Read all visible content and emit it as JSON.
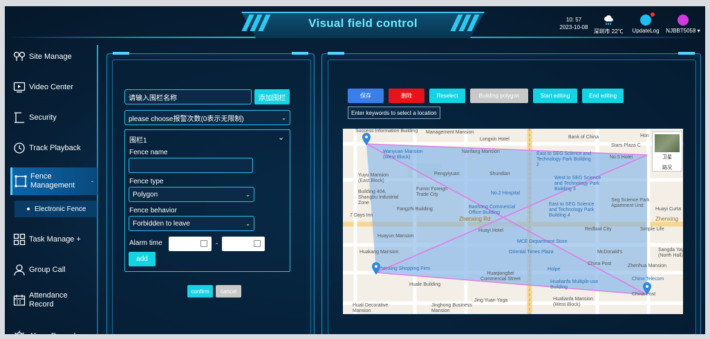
{
  "header": {
    "title": "Visual field control",
    "time": "10: 57",
    "date": "2023-10-08",
    "weather": "深圳市 22℃",
    "updatelog": "UpdateLog",
    "user": "NJBBT5058"
  },
  "sidebar": {
    "items": [
      {
        "label": "Site Manage",
        "icon": "location-pins-icon"
      },
      {
        "label": "Video Center",
        "icon": "video-play-icon"
      },
      {
        "label": "Security",
        "icon": "camera-icon"
      },
      {
        "label": "Track Playback",
        "icon": "history-icon"
      },
      {
        "label_lines": [
          "Fence",
          "Management"
        ],
        "caret": "-",
        "icon": "fence-icon"
      },
      {
        "label": "Task Manage +",
        "icon": "tasks-icon"
      },
      {
        "label": "Group Call",
        "icon": "group-icon"
      },
      {
        "label_lines": [
          "Attendance",
          "Record"
        ],
        "icon": "calendar-icon"
      },
      {
        "label": "Alarm Record",
        "icon": "alarm-icon"
      }
    ],
    "sub_item": "Electronic Fence"
  },
  "left_panel": {
    "fence_name_input": "请输入围栏名称",
    "add_fence_button": "添加围栏",
    "alarm_count_select": "please choose报警次数(0表示无限制)",
    "card": {
      "title": "围栏1",
      "fence_name_label": "Fence name",
      "fence_name_value": "",
      "fence_type_label": "Fence type",
      "fence_type_value": "Polygon",
      "fence_behavior_label": "Fence behavior",
      "fence_behavior_value": "Forbidden to leave",
      "alarm_time_label": "Alarm time",
      "separator": "-",
      "add_button": "add"
    },
    "confirm_button": "confirm",
    "cancel_button": "cancel"
  },
  "toolbar": {
    "save": "保存",
    "delete": "删除",
    "reselect": "Reselect",
    "building": "Building polygon",
    "start": "Start editing",
    "end": "End editing",
    "search_placeholder": "Enter keywords to select a location",
    "colors": {
      "save": "#3a7ee8",
      "delete": "#e8121b",
      "cyan": "#16d3e3",
      "disabled": "#c8c8c8"
    }
  },
  "map": {
    "labels": [
      "Success Information Building",
      "Management Mansion",
      "Longxin Hotel",
      "Bank of China",
      "Hon",
      "Wanyuan Mansion (West Block)",
      "Nanfang Mansion",
      "East to SEG Science and Technology Park Building 2",
      "Stars Plaza C",
      "No.5 Hotel",
      "Yuyu Mansion (East Block)",
      "Pengyiyuan",
      "Shundian",
      "West to SEG Science and Technology Park Building 3",
      "Building 404, Shangbu Industrial Zone",
      "Fumin Foreign Trade City",
      "No.2 Hospital",
      "East to SEG Science and Technology Park Building 4",
      "Seg Science Park Apartment Unit",
      "Huayi Curta",
      "Fangzhi Building",
      "Baohong Commercial Office Building",
      "Zhenxing Rd",
      "7 Days Inn",
      "Huayi Hotel",
      "Redbud City",
      "Simple Life",
      "Zhenxing",
      "Huayun Mansion",
      "MCE Department Store",
      "Huakang Mansion",
      "Oriental Times Plaza",
      "McDonald's",
      "Sangda Yay (North Hall)",
      "China Post",
      "Zhenhua Mansion",
      "Zhenxing Shopping Firm",
      "Huaqiangbei Commercial Street",
      "Holpe",
      "Hualianfa Multiple-use Building",
      "China Telecom",
      "Huale Building",
      "China Post",
      "Huali Decorative Mansion",
      "Jinghong Business Mansion",
      "Jing Yuan Yoga",
      "Hualianfa Mansion (West Block)"
    ],
    "sat_label": "卫星",
    "road_label": "路况"
  }
}
